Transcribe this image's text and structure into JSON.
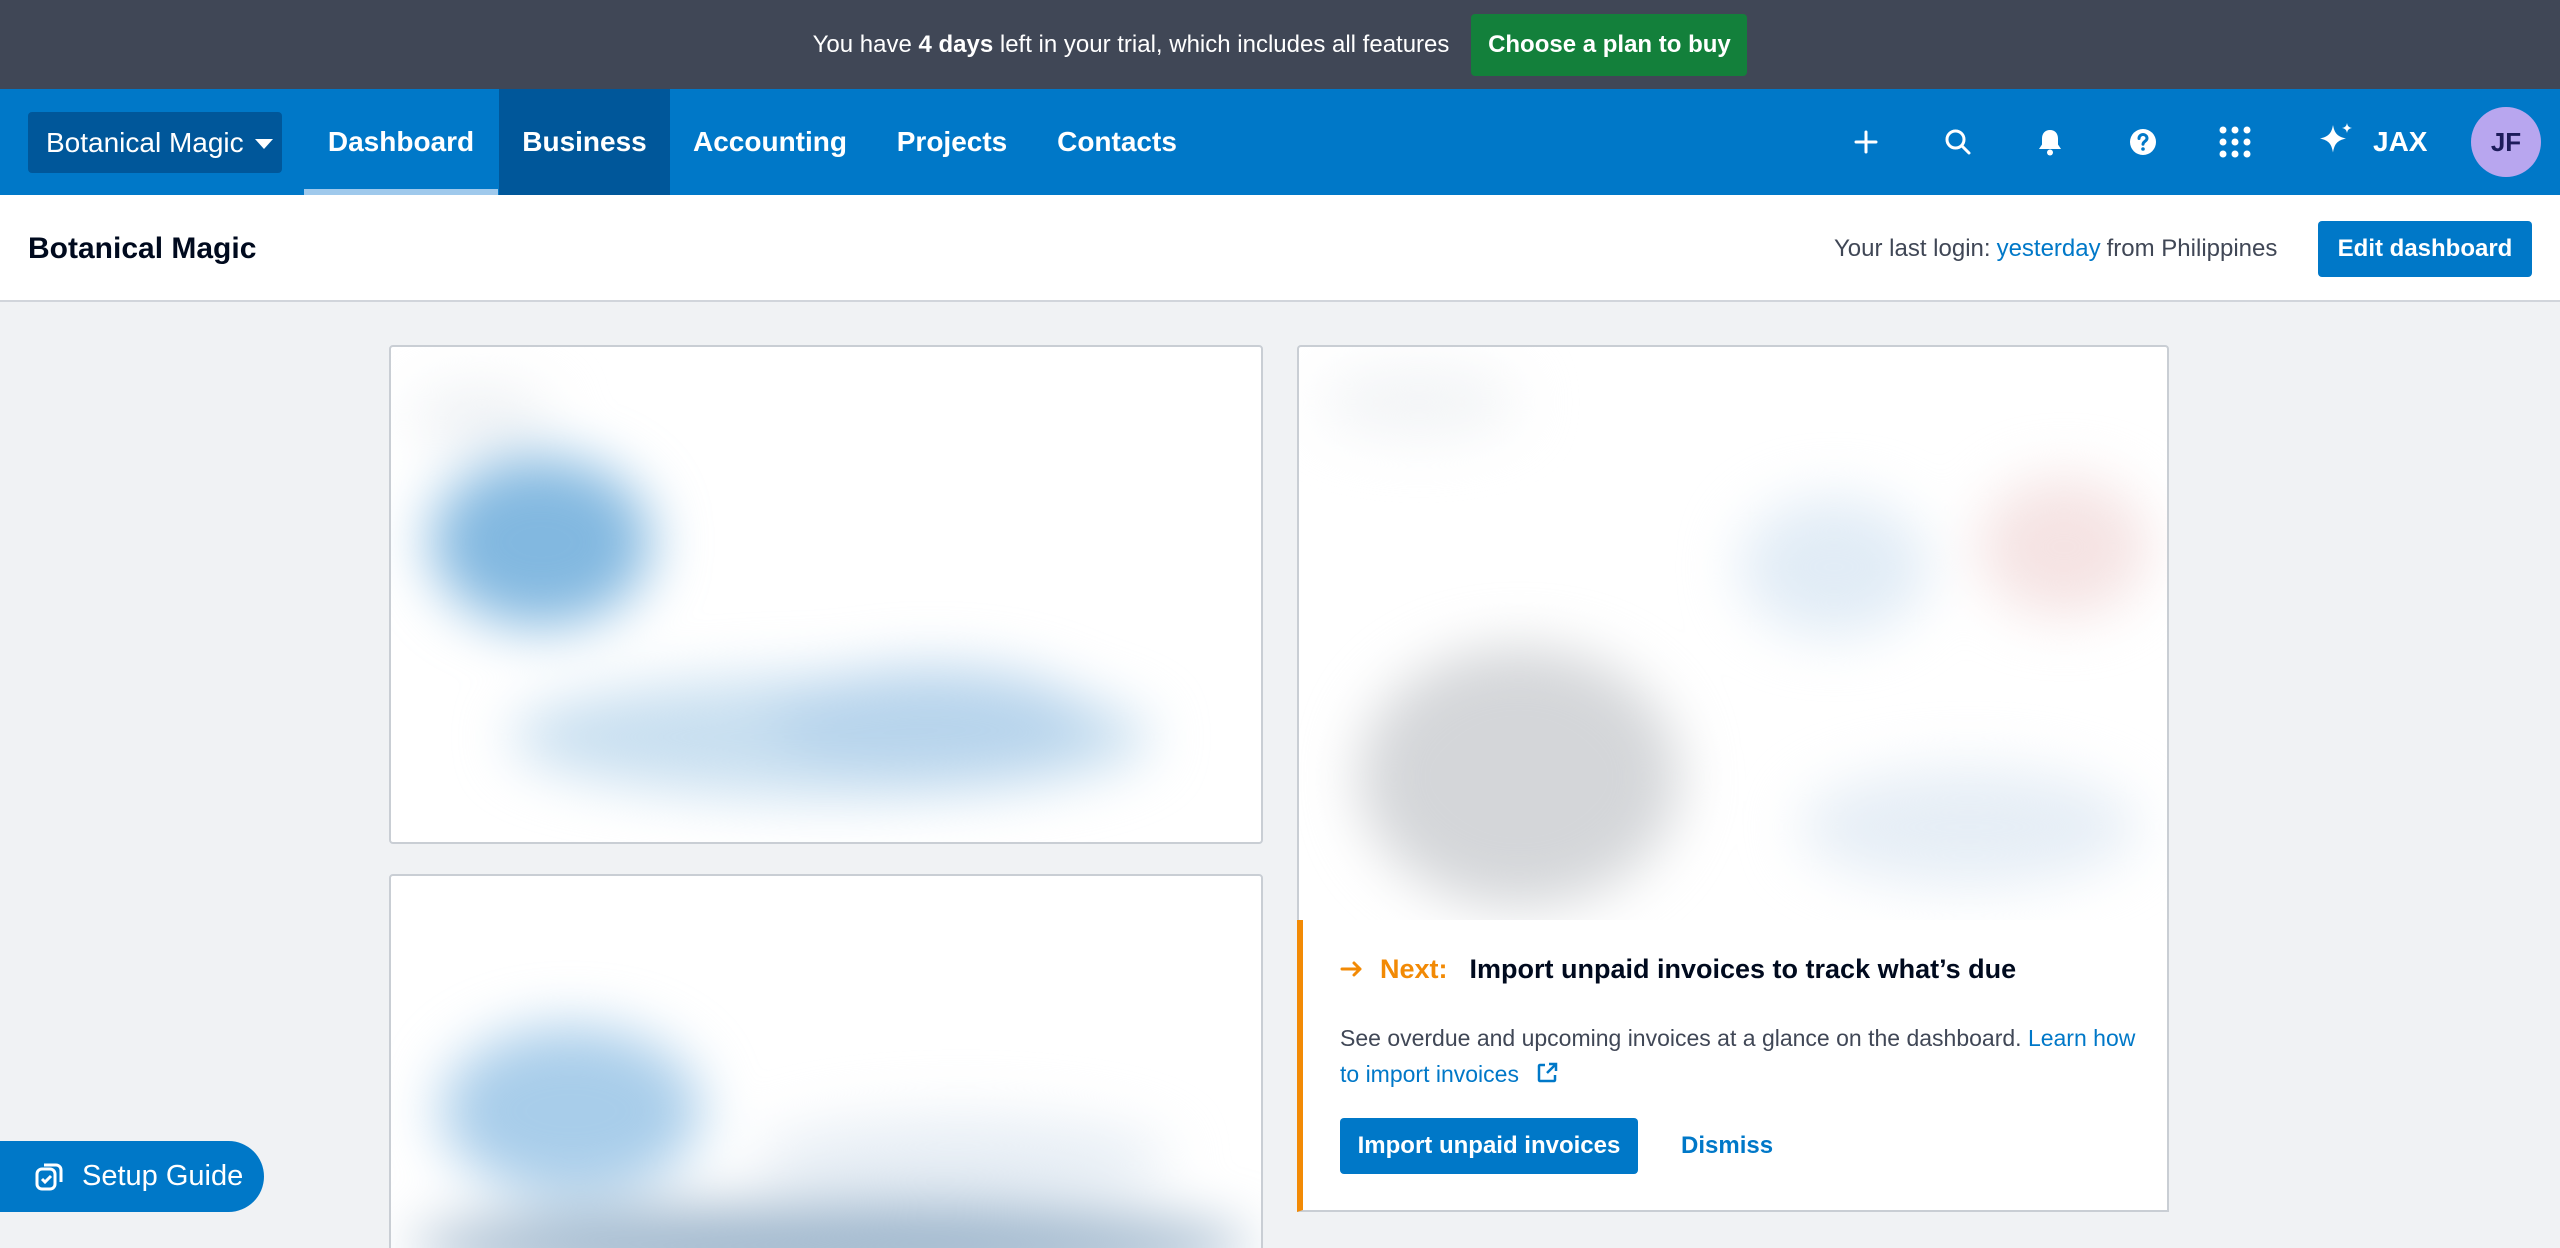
{
  "trial_banner": {
    "text_before": "You have ",
    "days": "4 days",
    "text_after": " left in your trial, which includes all features",
    "cta": "Choose a plan to buy"
  },
  "nav": {
    "org_name": "Botanical Magic",
    "tabs": [
      {
        "label": "Dashboard",
        "active": true
      },
      {
        "label": "Business"
      },
      {
        "label": "Accounting"
      },
      {
        "label": "Projects"
      },
      {
        "label": "Contacts"
      }
    ],
    "icons": [
      "plus-icon",
      "search-icon",
      "bell-icon",
      "help-icon",
      "apps-grid-icon",
      "sparkle-icon"
    ],
    "jax_label": "JAX",
    "avatar_initials": "JF"
  },
  "subheader": {
    "title": "Botanical Magic",
    "last_login_prefix": "Your last login:",
    "last_login_when": "yesterday",
    "last_login_suffix": "from Philippines",
    "edit_button": "Edit dashboard"
  },
  "next_step": {
    "label": "Next:",
    "title": "Import unpaid invoices to track what’s due",
    "description": "See overdue and upcoming invoices at a glance on the dashboard.",
    "learn_link": "Learn how to import invoices",
    "primary_button": "Import unpaid invoices",
    "dismiss_button": "Dismiss"
  },
  "setup_guide": {
    "label": "Setup Guide"
  },
  "colors": {
    "banner_bg": "#404756",
    "cta_green": "#13803b",
    "nav_blue": "#0078c8",
    "nav_dark": "#00579a",
    "accent_orange": "#f28a05",
    "avatar_bg": "#b8a6ef"
  }
}
